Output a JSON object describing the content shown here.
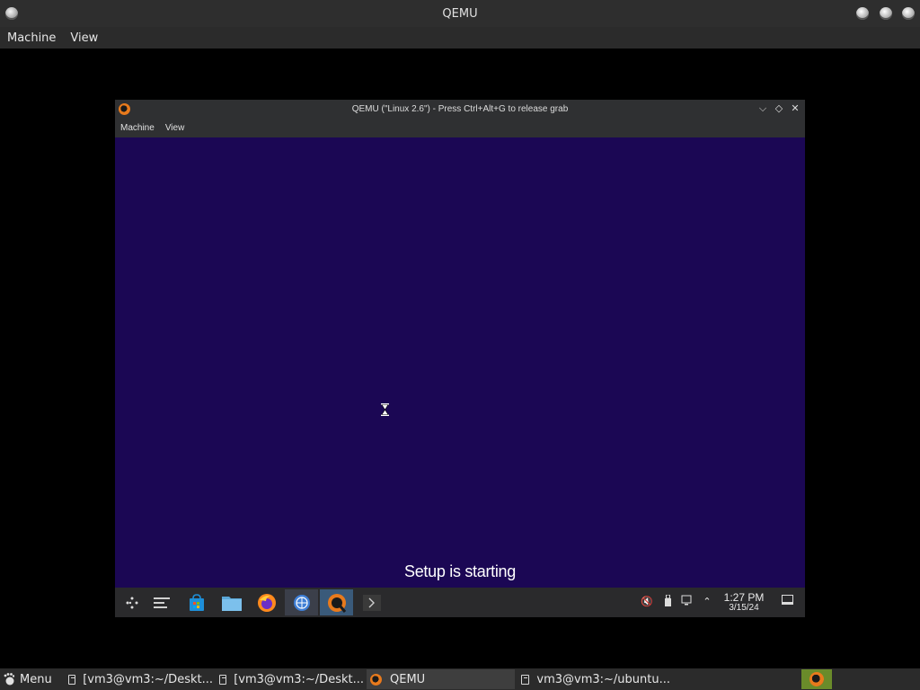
{
  "outer_window": {
    "title": "QEMU",
    "menu": [
      "Machine",
      "View"
    ]
  },
  "inner_window": {
    "title": "QEMU (\"Linux 2.6\") - Press Ctrl+Alt+G to release grab",
    "menu": [
      "Machine",
      "View"
    ],
    "controls": {
      "minimize": "⌵",
      "maximize": "◇",
      "close": "✕"
    }
  },
  "guest_screen": {
    "background": "#1b0754",
    "status_text": "Setup is starting",
    "cursor": "hourglass-icon"
  },
  "guest_taskbar": {
    "icons": [
      "start-menu-icon",
      "window-switcher-icon",
      "store-bag-icon",
      "file-manager-icon",
      "firefox-icon",
      "globe-browser-icon",
      "qemu-icon",
      "terminal-chevron-icon"
    ],
    "tray": [
      "speaker-muted-icon",
      "usb-drive-icon",
      "network-icon",
      "chevron-up-icon"
    ],
    "time": "1:27 PM",
    "date": "3/15/24",
    "notification_icon": "notification-icon"
  },
  "host_panel": {
    "menu_label": "Menu",
    "tasks": [
      {
        "label": "[vm3@vm3:~/Deskt...",
        "icon": "terminal-icon"
      },
      {
        "label": "[vm3@vm3:~/Deskt...",
        "icon": "terminal-icon"
      },
      {
        "label": "QEMU",
        "icon": "qemu-icon"
      },
      {
        "label": "vm3@vm3:~/ubuntu...",
        "icon": "terminal-icon"
      }
    ]
  }
}
